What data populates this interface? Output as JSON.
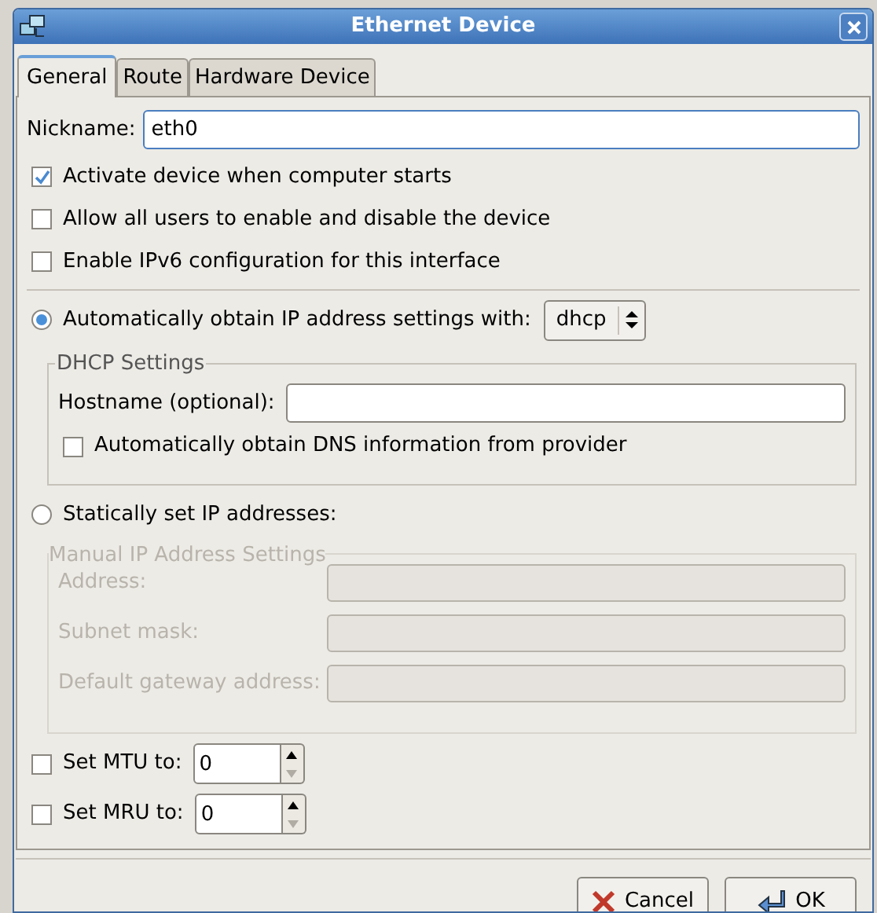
{
  "window": {
    "title": "Ethernet Device"
  },
  "tabs": [
    {
      "label": "General",
      "selected": true
    },
    {
      "label": "Route",
      "selected": false
    },
    {
      "label": "Hardware Device",
      "selected": false
    }
  ],
  "nickname": {
    "label": "Nickname:",
    "value": "eth0"
  },
  "options": [
    {
      "label": "Activate device when computer starts",
      "checked": true
    },
    {
      "label": "Allow all users to enable and disable the device",
      "checked": false
    },
    {
      "label": "Enable IPv6 configuration for this interface",
      "checked": false
    }
  ],
  "auto_ip": {
    "label": "Automatically obtain IP address settings with:",
    "selected": true,
    "method": "dhcp"
  },
  "dhcp_settings": {
    "title": "DHCP Settings",
    "hostname_label": "Hostname (optional):",
    "dns": {
      "label": "Automatically obtain DNS information from provider",
      "checked": false
    }
  },
  "static_ip": {
    "label": "Statically set IP addresses:",
    "selected": false
  },
  "manual_settings": {
    "title": "Manual IP Address Settings",
    "disabled": true,
    "fields": [
      {
        "label": "Address:"
      },
      {
        "label": "Subnet mask:"
      },
      {
        "label": "Default gateway address:"
      }
    ]
  },
  "mtu": {
    "label": "Set MTU to:",
    "checked": false,
    "value": "0"
  },
  "mru": {
    "label": "Set MRU to:",
    "checked": false,
    "value": "0"
  },
  "buttons": [
    {
      "label": "Cancel",
      "kind": "cancel"
    },
    {
      "label": "OK",
      "kind": "ok"
    }
  ]
}
